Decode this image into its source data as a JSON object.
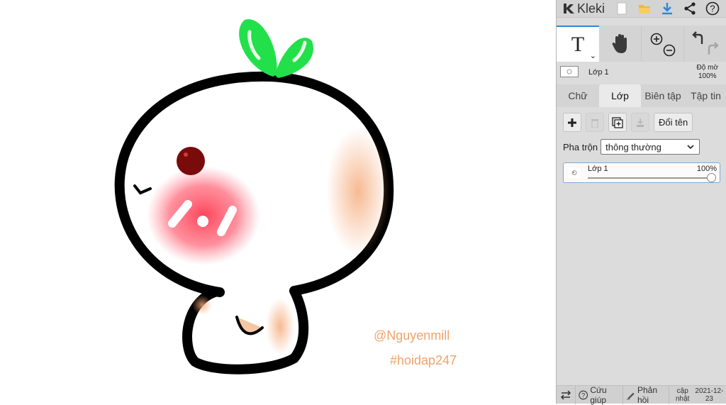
{
  "app": {
    "name": "Kleki"
  },
  "toolbar": {
    "new_icon": "new-file-icon",
    "open_icon": "folder-icon",
    "download_icon": "download-icon",
    "share_icon": "share-icon",
    "help_icon": "help-icon",
    "accent": "#2f86d6"
  },
  "tools": {
    "text_glyph": "T",
    "text_caret": "⌄",
    "hand_icon": "hand-icon",
    "zoom_in_icon": "zoom-in-icon",
    "zoom_out_icon": "zoom-out-icon",
    "undo_icon": "undo-icon",
    "redo_icon": "redo-icon"
  },
  "current_layer": {
    "name": "Lớp 1",
    "opacity_label": "Độ mờ",
    "opacity_value": "100%"
  },
  "tabs": [
    {
      "label": "Chữ",
      "active": false
    },
    {
      "label": "Lớp",
      "active": true
    },
    {
      "label": "Biên tập",
      "active": false
    },
    {
      "label": "Tập tin",
      "active": false
    }
  ],
  "layers_panel": {
    "rename_label": "Đổi tên",
    "blend_label": "Pha trộn",
    "blend_value": "thông thường",
    "layers": [
      {
        "name": "Lớp 1",
        "opacity": "100%",
        "opacity_fraction": 1.0
      }
    ]
  },
  "canvas": {
    "watermark_line1": "@Nguyenmill",
    "watermark_line2": "#hoidap247",
    "watermark_color": "#f0a36a"
  },
  "footer": {
    "help_label": "Cứu giúp",
    "feedback_label": "Phản hồi",
    "update_label": "cập nhật",
    "update_date": "2021-12-23"
  }
}
